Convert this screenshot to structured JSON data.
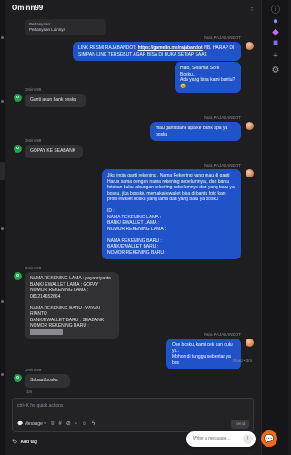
{
  "header": {
    "title": "Ominn99"
  },
  "quoted": {
    "line1": "Pertanyaan:",
    "line2": "Pertanyaan Lainnya"
  },
  "messages": {
    "m1": {
      "sender": "Fara RAJABANDOT",
      "text_pre": "LINK RESMI RAJABANDOT: ",
      "link": "https://gamelin.me/rajabandot",
      "text_post": " NB. HARAP DI SIMPAN LINK TERSEBUT AGAR BISA DI BUKA SETIAP SAAT."
    },
    "m2": {
      "text": "Halo, Selamat Sore Bosku..\nAda yang bisa kami bantu? 😊"
    },
    "m3": {
      "sender": "Ominn99",
      "text": "Ganti akun bank bosku"
    },
    "m4": {
      "sender": "Fara RAJABANDOT",
      "text": "mau ganti bank apa ke bank apa ya bosku"
    },
    "m5": {
      "sender": "Ominn99",
      "text": "GOPAY KE SEABANK"
    },
    "m6": {
      "sender": "Fara RAJABANDOT",
      "text": "Jika ingin ganti rekening , Nama Rekening yang mau di ganti Harus sama dengan nama rekening sebelumnya , dan bantu fotokan buku tabungan rekening sebelumnya dan yang baru ya bosku, jika bosskiu memakai ewallet bisa di bantu foto kan profil ewallet bosku yang lama dan yang baru ya bosku\n\nID :\nNAMA REKENING LAMA :\nBANK/ EWALLET LAMA :\nNOMOR REKENING LAMA :\n\nNAMA REKENING BARU :\nBANK/EWALLET BARU :\nNOMOR REKENING BARU :"
    },
    "m7": {
      "sender": "Ominn99",
      "text": "NAMA REKENING LAMA : yayanriyanto\nBANK/ EWALLET LAMA : GOPAY\nNOMOR REKENING LAMA : 081214652664\n\nNAMA REKENING BARU : YAYAN RIANTO\nBANK/EWALLET BARU : SEABANK\nNOMOR REKENING BARU : ",
      "redacted": "1234567890123"
    },
    "m8": {
      "sender": "Fara RAJABANDOT",
      "text": "Oke bosku, kami cek kan dulu ya..\nMohon di tunggu sebentar ya bos",
      "status": "Read • 3m"
    },
    "m9": {
      "sender": "Ominn99",
      "text": "Sabaat bosku",
      "time": "1m"
    }
  },
  "composer": {
    "placeholder": "ctrl+K for quick actions",
    "message_label": "Message",
    "send_label": "Send"
  },
  "tagbar": {
    "label": "Add tag"
  },
  "widget": {
    "placeholder": "Write a message..."
  },
  "colors": {
    "accent": "#1f53c7",
    "widget_fab": "#f26a1b",
    "customer_avatar": "#1fa24a"
  }
}
